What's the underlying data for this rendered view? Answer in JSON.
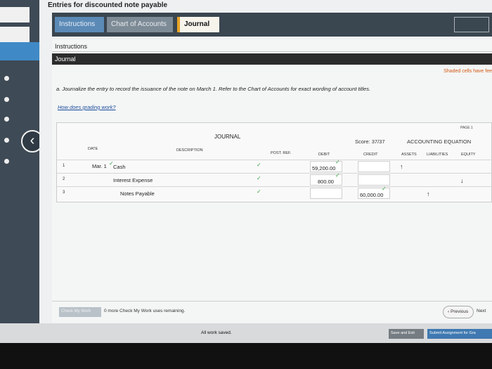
{
  "window": {
    "title": "Entries for discounted note payable"
  },
  "tabs": {
    "instructions": "Instructions",
    "chart": "Chart of Accounts",
    "journal": "Journal"
  },
  "instructions": {
    "heading": "Instructions",
    "journal_bar": "Journal",
    "shaded_note": "Shaded cells have fee"
  },
  "prompt": "a. Journalize the entry to record the issuance of the note on March 1. Refer to the Chart of Accounts for exact wording of account titles.",
  "grading_link": "How does grading work?",
  "journal": {
    "title": "JOURNAL",
    "page": "PAGE 1",
    "score": "Score: 37/37",
    "equation_title": "ACCOUNTING EQUATION",
    "headers": {
      "date": "DATE",
      "description": "DESCRIPTION",
      "post_ref": "POST. REF.",
      "debit": "DEBIT",
      "credit": "CREDIT",
      "assets": "ASSETS",
      "liabilities": "LIABILITIES",
      "equity": "EQUITY"
    },
    "rows": [
      {
        "num": "1",
        "date": "Mar. 1",
        "description": "Cash",
        "debit": "59,200.00",
        "credit": "",
        "arrow_assets": "↑",
        "arrow_liabilities": "",
        "arrow_equity": ""
      },
      {
        "num": "2",
        "date": "",
        "description": "Interest Expense",
        "debit": "800.00",
        "credit": "",
        "arrow_assets": "",
        "arrow_liabilities": "",
        "arrow_equity": "↓"
      },
      {
        "num": "3",
        "date": "",
        "description": "Notes Payable",
        "debit": "",
        "credit": "60,000.00",
        "arrow_assets": "",
        "arrow_liabilities": "↑",
        "arrow_equity": ""
      }
    ]
  },
  "footer": {
    "check_button": "Check My Work",
    "remaining": "0 more Check My Work uses remaining.",
    "previous": "Previous",
    "next": "Next"
  },
  "bottom": {
    "saved": "All work saved.",
    "save_exit": "Save and Exit",
    "submit": "Submit Assignment for Gra"
  }
}
